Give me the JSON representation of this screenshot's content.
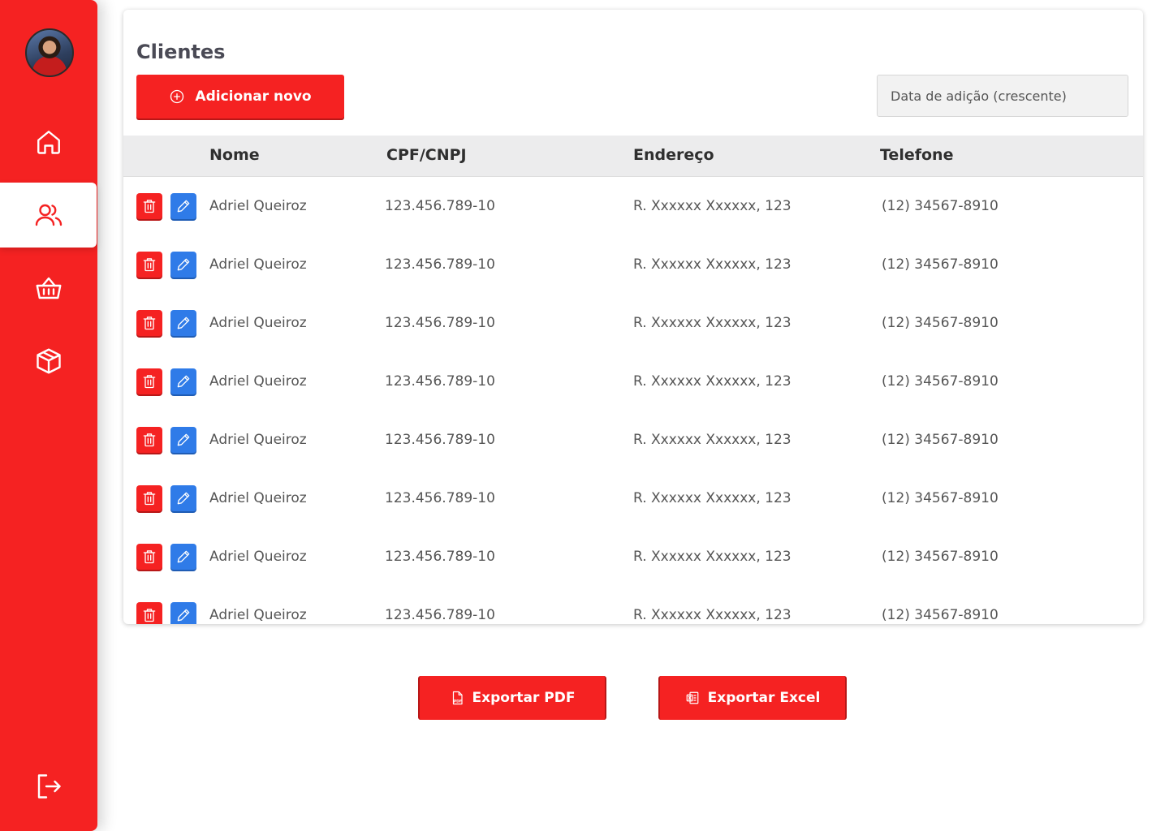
{
  "sidebar": {
    "nav": [
      {
        "icon": "home-icon"
      },
      {
        "icon": "users-icon",
        "active": true
      },
      {
        "icon": "basket-icon"
      },
      {
        "icon": "box-icon"
      }
    ],
    "logout_icon": "logout-icon"
  },
  "page": {
    "title": "Clientes",
    "add_button": "Adicionar novo",
    "sort_value": "Data de adição (crescente)"
  },
  "table": {
    "headers": [
      "Nome",
      "CPF/CNPJ",
      "Endereço",
      "Telefone"
    ],
    "rows": [
      {
        "nome": "Adriel Queiroz",
        "doc": "123.456.789-10",
        "endereco": "R. Xxxxxx Xxxxxx, 123",
        "telefone": "(12) 34567-8910"
      },
      {
        "nome": "Adriel Queiroz",
        "doc": "123.456.789-10",
        "endereco": "R. Xxxxxx Xxxxxx, 123",
        "telefone": "(12) 34567-8910"
      },
      {
        "nome": "Adriel Queiroz",
        "doc": "123.456.789-10",
        "endereco": "R. Xxxxxx Xxxxxx, 123",
        "telefone": "(12) 34567-8910"
      },
      {
        "nome": "Adriel Queiroz",
        "doc": "123.456.789-10",
        "endereco": "R. Xxxxxx Xxxxxx, 123",
        "telefone": "(12) 34567-8910"
      },
      {
        "nome": "Adriel Queiroz",
        "doc": "123.456.789-10",
        "endereco": "R. Xxxxxx Xxxxxx, 123",
        "telefone": "(12) 34567-8910"
      },
      {
        "nome": "Adriel Queiroz",
        "doc": "123.456.789-10",
        "endereco": "R. Xxxxxx Xxxxxx, 123",
        "telefone": "(12) 34567-8910"
      },
      {
        "nome": "Adriel Queiroz",
        "doc": "123.456.789-10",
        "endereco": "R. Xxxxxx Xxxxxx, 123",
        "telefone": "(12) 34567-8910"
      },
      {
        "nome": "Adriel Queiroz",
        "doc": "123.456.789-10",
        "endereco": "R. Xxxxxx Xxxxxx, 123",
        "telefone": "(12) 34567-8910"
      }
    ]
  },
  "export": {
    "pdf_label": "Exportar PDF",
    "excel_label": "Exportar Excel"
  },
  "colors": {
    "accent_red": "#f52222",
    "edit_blue": "#2f7be8"
  }
}
